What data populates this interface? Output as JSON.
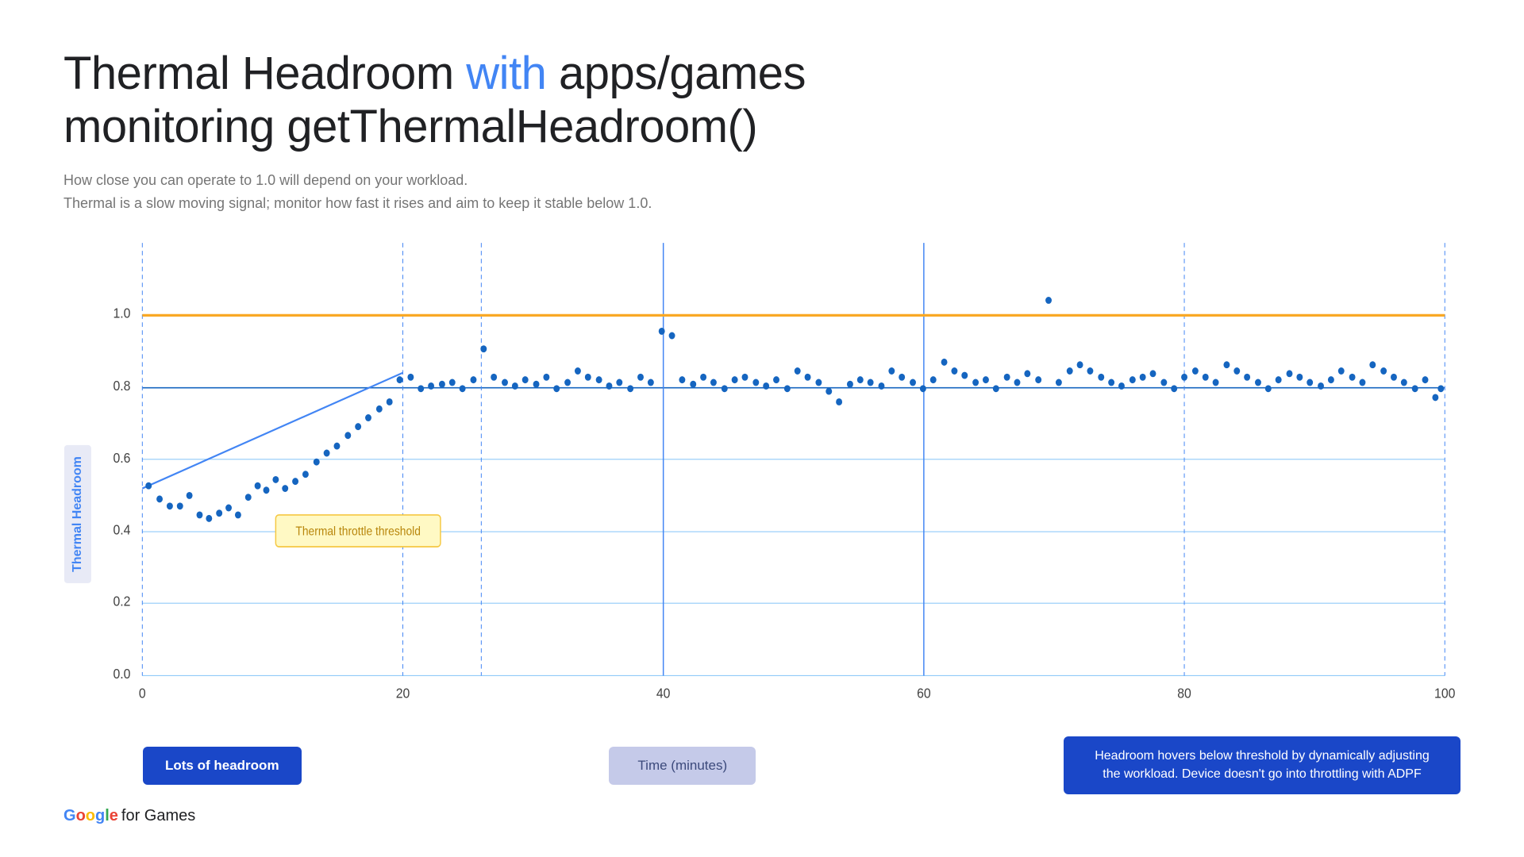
{
  "title": {
    "part1": "Thermal Headroom ",
    "highlight": "with",
    "part2": " apps/games",
    "line2": "monitoring getThermalHeadroom()"
  },
  "subtitle": {
    "line1": "How close you can operate to 1.0 will depend on your workload.",
    "line2": "Thermal is a slow moving signal; monitor how fast it rises and aim to keep it stable below 1.0."
  },
  "chart": {
    "y_label": "Thermal Headroom",
    "x_label": "Time (minutes)",
    "y_ticks": [
      "1.0",
      "0.8",
      "0.6",
      "0.4",
      "0.2",
      "0.0"
    ],
    "x_ticks": [
      "0",
      "20",
      "40",
      "60",
      "80",
      "100"
    ],
    "threshold_label": "Thermal throttle threshold",
    "threshold_value": 1.0
  },
  "labels": {
    "lots_headroom": "Lots of headroom",
    "time_minutes": "Time (minutes)",
    "adpf_description": "Headroom hovers below threshold by dynamically adjusting the workload. Device doesn't go into throttling with ADPF"
  },
  "google_logo": {
    "text": "Google for Games"
  },
  "colors": {
    "accent_blue": "#4285F4",
    "threshold_yellow": "#F9A825",
    "dot_blue": "#1565C0",
    "grid_blue": "#90CAF9",
    "dashed_blue": "#4285F4",
    "solid_blue": "#1565C0",
    "label_dark": "#1a47c8"
  }
}
